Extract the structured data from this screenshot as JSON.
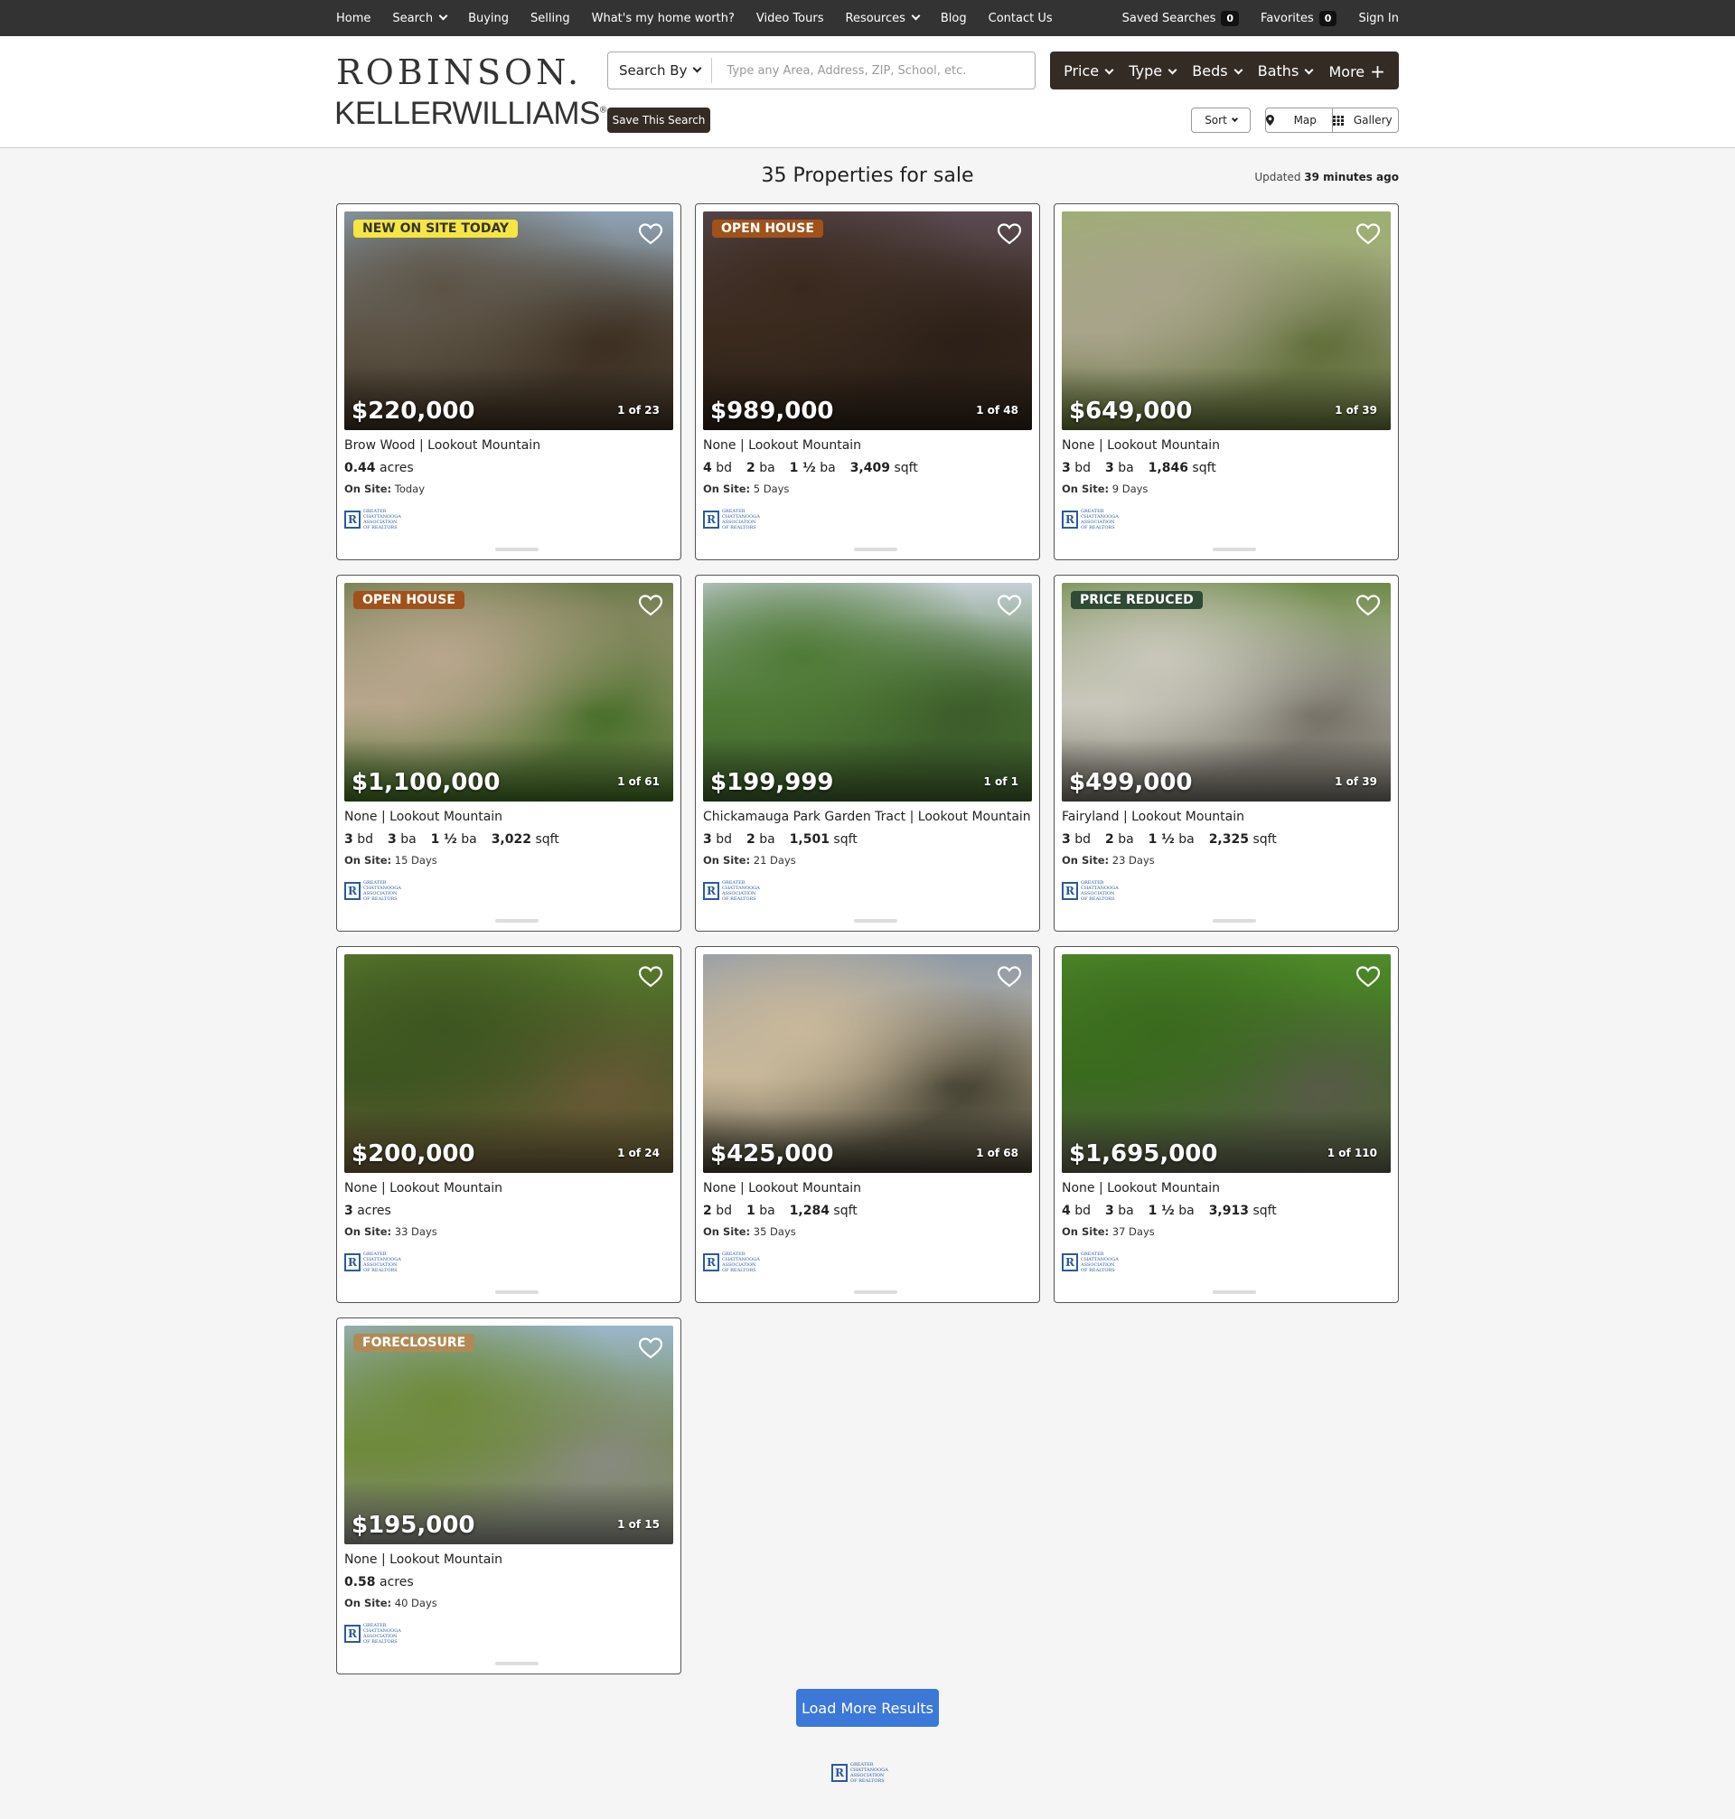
{
  "topnav": {
    "links": [
      "Home",
      "Search",
      "Buying",
      "Selling",
      "What's my home worth?",
      "Video Tours",
      "Resources",
      "Blog",
      "Contact Us"
    ],
    "saved_searches_label": "Saved Searches",
    "saved_searches_count": "0",
    "favorites_label": "Favorites",
    "favorites_count": "0",
    "sign_in": "Sign In"
  },
  "header": {
    "logo_line1": "ROBINSON.",
    "logo_line2": "KELLERWILLIAMS",
    "logo_mark": "®",
    "search_by": "Search By",
    "search_placeholder": "Type any Area, Address, ZIP, School, etc.",
    "filters": [
      "Price",
      "Type",
      "Beds",
      "Baths",
      "More"
    ],
    "save_search": "Save This Search",
    "sort": "Sort",
    "map": "Map",
    "gallery": "Gallery"
  },
  "results": {
    "title": "35 Properties for sale",
    "updated_prefix": "Updated",
    "updated_value": "39 minutes ago"
  },
  "gcar": {
    "mark": "R",
    "line1": "Greater",
    "line2": "Chattanooga",
    "line3": "Association",
    "line4": "of Realtors"
  },
  "listings": [
    {
      "tag": "NEW ON SITE TODAY",
      "tag_bg": "#f5e642",
      "tag_fg": "#333333",
      "price": "$220,000",
      "photo_count": "1 of 23",
      "location": "Brow Wood | Lookout Mountain",
      "stats": [
        {
          "v": "0.44",
          "u": "acres"
        }
      ],
      "onsite_label": "On Site:",
      "onsite": "Today",
      "colors": [
        "#8fa3b5",
        "#5d5446",
        "#3a2d20"
      ]
    },
    {
      "tag": "OPEN HOUSE",
      "tag_bg": "#a0521a",
      "tag_fg": "#ffffff",
      "price": "$989,000",
      "photo_count": "1 of 48",
      "location": "None | Lookout Mountain",
      "stats": [
        {
          "v": "4",
          "u": "bd"
        },
        {
          "v": "2",
          "u": "ba"
        },
        {
          "v": "1 ½",
          "u": "ba"
        },
        {
          "v": "3,409",
          "u": "sqft"
        }
      ],
      "onsite_label": "On Site:",
      "onsite": "5 Days",
      "colors": [
        "#5b4a52",
        "#3a2a1e",
        "#2a1f17"
      ]
    },
    {
      "tag": "",
      "tag_bg": "",
      "tag_fg": "",
      "price": "$649,000",
      "photo_count": "1 of 39",
      "location": "None | Lookout Mountain",
      "stats": [
        {
          "v": "3",
          "u": "bd"
        },
        {
          "v": "3",
          "u": "ba"
        },
        {
          "v": "1,846",
          "u": "sqft"
        }
      ],
      "onsite_label": "On Site:",
      "onsite": "9 Days",
      "colors": [
        "#9cb070",
        "#a8a48a",
        "#5b6b34"
      ]
    },
    {
      "tag": "OPEN HOUSE",
      "tag_bg": "#a0521a",
      "tag_fg": "#ffffff",
      "price": "$1,100,000",
      "photo_count": "1 of 61",
      "location": "None | Lookout Mountain",
      "stats": [
        {
          "v": "3",
          "u": "bd"
        },
        {
          "v": "3",
          "u": "ba"
        },
        {
          "v": "1 ½",
          "u": "ba"
        },
        {
          "v": "3,022",
          "u": "sqft"
        }
      ],
      "onsite_label": "On Site:",
      "onsite": "15 Days",
      "colors": [
        "#6d7a4b",
        "#b8a68c",
        "#3f6a22"
      ]
    },
    {
      "tag": "",
      "tag_bg": "",
      "tag_fg": "",
      "price": "$199,999",
      "photo_count": "1 of 1",
      "location": "Chickamauga Park Garden Tract | Lookout Mountain",
      "stats": [
        {
          "v": "3",
          "u": "bd"
        },
        {
          "v": "2",
          "u": "ba"
        },
        {
          "v": "1,501",
          "u": "sqft"
        }
      ],
      "onsite_label": "On Site:",
      "onsite": "21 Days",
      "colors": [
        "#c5cfd6",
        "#4f7a36",
        "#3b5a2a"
      ]
    },
    {
      "tag": "PRICE REDUCED",
      "tag_bg": "#2f4a35",
      "tag_fg": "#ffffff",
      "price": "$499,000",
      "photo_count": "1 of 39",
      "location": "Fairyland | Lookout Mountain",
      "stats": [
        {
          "v": "3",
          "u": "bd"
        },
        {
          "v": "2",
          "u": "ba"
        },
        {
          "v": "1 ½",
          "u": "ba"
        },
        {
          "v": "2,325",
          "u": "sqft"
        }
      ],
      "onsite_label": "On Site:",
      "onsite": "23 Days",
      "colors": [
        "#6f8a4a",
        "#c9c7bb",
        "#6f6b62"
      ]
    },
    {
      "tag": "",
      "tag_bg": "",
      "tag_fg": "",
      "price": "$200,000",
      "photo_count": "1 of 24",
      "location": "None | Lookout Mountain",
      "stats": [
        {
          "v": "3",
          "u": "acres"
        }
      ],
      "onsite_label": "On Site:",
      "onsite": "33 Days",
      "colors": [
        "#5a7a2e",
        "#3d5520",
        "#6b5a38"
      ]
    },
    {
      "tag": "",
      "tag_bg": "",
      "tag_fg": "",
      "price": "$425,000",
      "photo_count": "1 of 68",
      "location": "None | Lookout Mountain",
      "stats": [
        {
          "v": "2",
          "u": "bd"
        },
        {
          "v": "1",
          "u": "ba"
        },
        {
          "v": "1,284",
          "u": "sqft"
        }
      ],
      "onsite_label": "On Site:",
      "onsite": "35 Days",
      "colors": [
        "#8e9aa8",
        "#c9b89a",
        "#3c3a2c"
      ]
    },
    {
      "tag": "",
      "tag_bg": "",
      "tag_fg": "",
      "price": "$1,695,000",
      "photo_count": "1 of 110",
      "location": "None | Lookout Mountain",
      "stats": [
        {
          "v": "4",
          "u": "bd"
        },
        {
          "v": "3",
          "u": "ba"
        },
        {
          "v": "1 ½",
          "u": "ba"
        },
        {
          "v": "3,913",
          "u": "sqft"
        }
      ],
      "onsite_label": "On Site:",
      "onsite": "37 Days",
      "colors": [
        "#4f8a2a",
        "#3a6a1e",
        "#5a5a4a"
      ]
    },
    {
      "tag": "FORECLOSURE",
      "tag_bg": "#b08a56",
      "tag_fg": "#ffffff",
      "price": "$195,000",
      "photo_count": "1 of 15",
      "location": "None | Lookout Mountain",
      "stats": [
        {
          "v": "0.58",
          "u": "acres"
        }
      ],
      "onsite_label": "On Site:",
      "onsite": "40 Days",
      "colors": [
        "#9cb6cc",
        "#6e8a3a",
        "#8a8a86"
      ]
    }
  ],
  "load_more": "Load More Results"
}
